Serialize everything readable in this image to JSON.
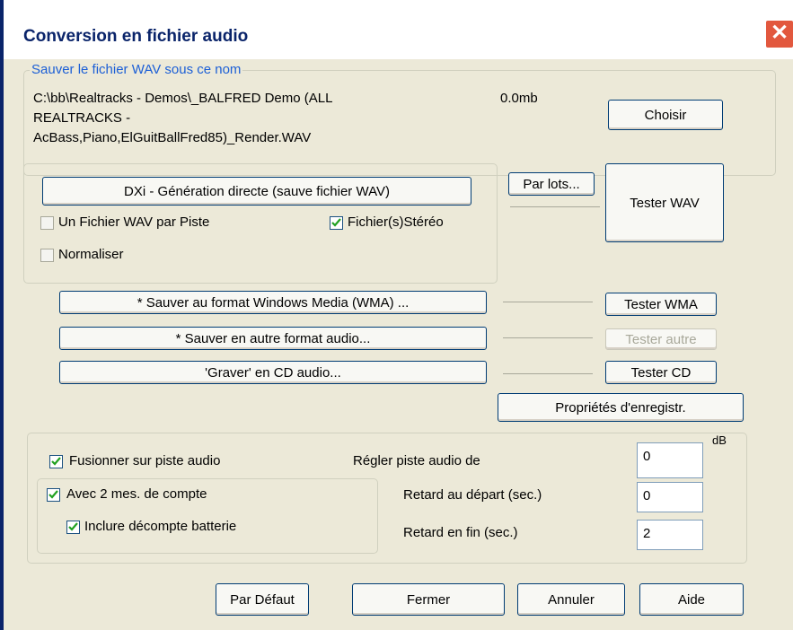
{
  "window": {
    "title": "Conversion en fichier audio",
    "close_symbol": "✕"
  },
  "file_group": {
    "legend": "Sauver le fichier WAV sous ce nom",
    "path_lines": [
      "C:\\bb\\Realtracks - Demos\\_BALFRED Demo (ALL",
      "REALTRACKS -",
      "AcBass,Piano,ElGuitBallFred85)_Render.WAV"
    ],
    "size": "0.0mb",
    "choose_label": "Choisir"
  },
  "dxi_group": {
    "generate_label": "DXi - Génération directe (sauve fichier WAV)",
    "one_file_per_track": {
      "label": "Un Fichier WAV par Piste",
      "checked": false
    },
    "stereo": {
      "label": "Fichier(s)Stéréo",
      "checked": true
    },
    "normalize": {
      "label": "Normaliser",
      "checked": false
    }
  },
  "batch_label": "Par lots...",
  "test_wav_label": "Tester WAV",
  "formats": {
    "wma_label": "* Sauver au format Windows Media (WMA) ...",
    "other_label": "* Sauver en autre format audio...",
    "cd_label": "'Graver' en CD audio...",
    "test_wma_label": "Tester WMA",
    "test_other_label": "Tester autre",
    "test_cd_label": "Tester CD",
    "properties_label": "Propriétés d'enregistr."
  },
  "merge_group": {
    "merge": {
      "label": "Fusionner sur piste audio",
      "checked": true
    },
    "count_in": {
      "label": "Avec 2 mes. de compte",
      "checked": true
    },
    "drum_countdown": {
      "label": "Inclure décompte batterie",
      "checked": true
    },
    "adjust_label": "Régler piste audio de",
    "adjust_value": "0",
    "db_unit": "dB",
    "start_delay_label": "Retard au départ (sec.)",
    "start_delay_value": "0",
    "end_delay_label": "Retard en fin (sec.)",
    "end_delay_value": "2"
  },
  "footer": {
    "default_label": "Par Défaut",
    "close_label": "Fermer",
    "cancel_label": "Annuler",
    "help_label": "Aide"
  },
  "colors": {
    "title": "#0a246a",
    "legend": "#1c5fd6",
    "check": "#21a121",
    "face": "#ece9d8"
  }
}
